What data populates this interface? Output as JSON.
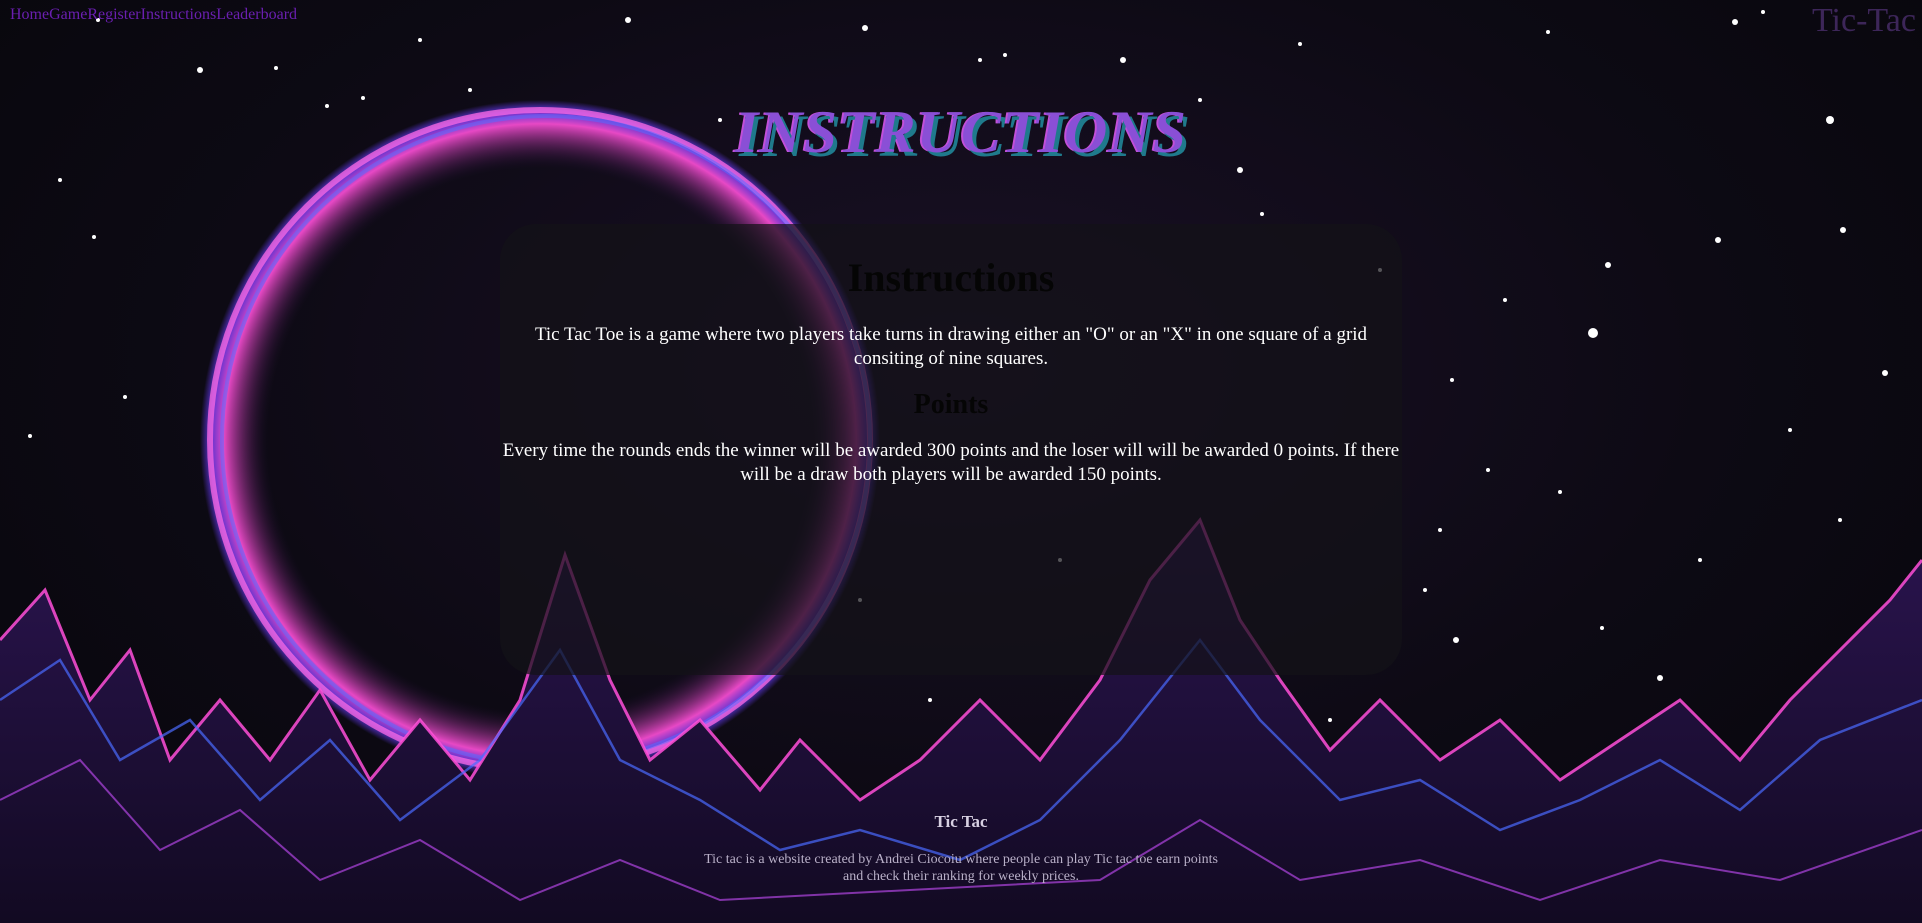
{
  "nav": {
    "items": [
      "Home",
      "Game",
      "Register",
      "Instructions",
      "Leaderboard"
    ]
  },
  "brand": "Tic-Tac",
  "page_heading": "INSTRUCTIONS",
  "panel": {
    "title": "Instructions",
    "intro": "Tic Tac Toe is a game where two players take turns in drawing either an \"O\" or an \"X\" in one square of a grid consiting of nine squares.",
    "points_title": "Points",
    "points_text": "Every time the rounds ends the winner will be awarded 300 points and the loser will will be awarded 0 points. If there will be a draw both players will be awarded 150 points."
  },
  "footer": {
    "title": "Tic Tac",
    "text": "Tic tac is a website created by Andrei Ciocoiu where people can play Tic tac toe earn points and check their ranking for weekly prices."
  },
  "colors": {
    "nav_link": "#6a1fb0",
    "heading": "#8a4fd6",
    "heading_shadow": "#1f7a8c",
    "panel_bg": "#141218"
  }
}
